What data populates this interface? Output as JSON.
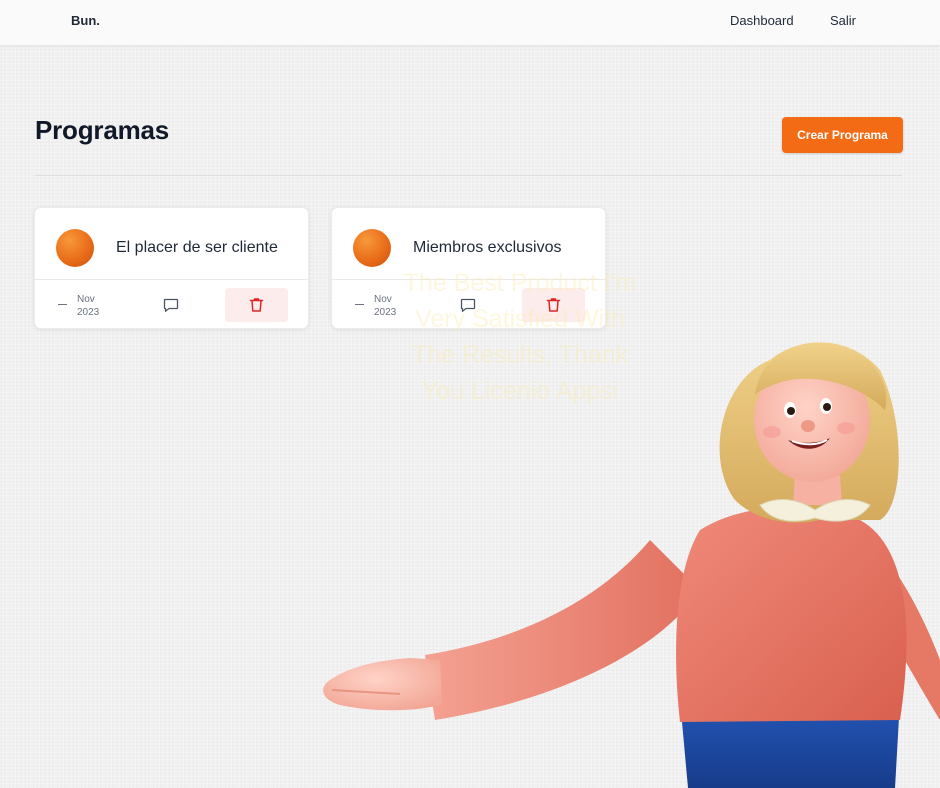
{
  "header": {
    "brand": "Bun.",
    "nav": {
      "dashboard": "Dashboard",
      "logout": "Salir"
    }
  },
  "page": {
    "title": "Programas",
    "create_button": "Crear Programa"
  },
  "programs": [
    {
      "title": "El placer de ser cliente",
      "month": "Nov",
      "year": "2023"
    },
    {
      "title": "Miembros exclusivos",
      "month": "Nov",
      "year": "2023"
    }
  ],
  "overlay": {
    "lines": [
      "The Best Product I'm",
      "Very Satisfied With",
      "The Results, Thank",
      "You Licenio Appsi"
    ]
  },
  "icons": {
    "comment": "comment-icon",
    "delete": "trash-icon"
  },
  "colors": {
    "accent": "#f46b16",
    "danger": "#dc2626",
    "danger_bg": "#fdecec",
    "avatar": "#ea6d1a"
  }
}
